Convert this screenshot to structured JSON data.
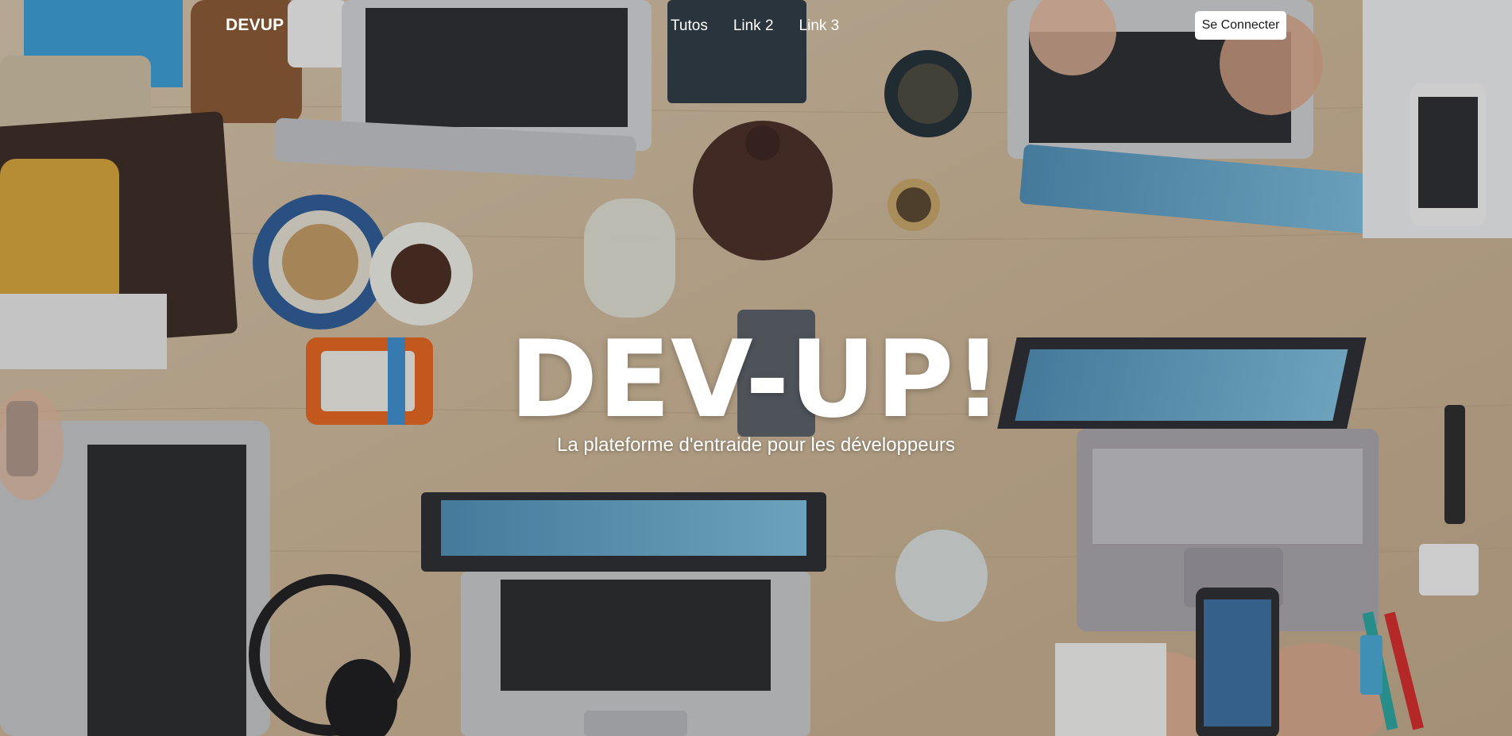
{
  "navbar": {
    "brand": "DEVUP",
    "links": [
      "Tutos",
      "Link 2",
      "Link 3"
    ],
    "login_label": "Se Connecter"
  },
  "hero": {
    "title": "DEV-UP!",
    "subtitle": "La plateforme d'entraide pour les développeurs",
    "background_image": "top-down photo of a wooden desk with laptops, phones, headphones, a teapot and cups",
    "colors": {
      "text": "#ffffff",
      "button_bg": "#ffffff",
      "button_text": "#1a1a1a",
      "desk_wood": "#c9b49a"
    }
  }
}
